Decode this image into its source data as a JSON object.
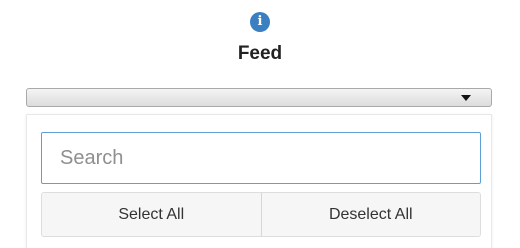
{
  "header": {
    "info_icon_glyph": "i",
    "title": "Feed"
  },
  "dropdown": {
    "selected_value": "",
    "caret_icon": "caret-down-icon"
  },
  "panel": {
    "search": {
      "value": "",
      "placeholder": "Search"
    },
    "select_all_label": "Select All",
    "deselect_all_label": "Deselect All"
  },
  "colors": {
    "accent": "#3a7fc2",
    "focus_border": "#5ea0d6"
  }
}
